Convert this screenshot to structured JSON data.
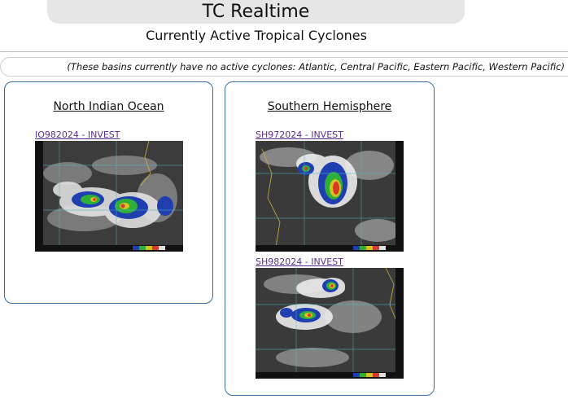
{
  "header": {
    "title": "TC Realtime",
    "subtitle": "Currently Active Tropical Cyclones"
  },
  "notice": "(These basins currently have no active cyclones: Atlantic, Central Pacific, Eastern Pacific, Western Pacific)",
  "basins": [
    {
      "name": "North Indian Ocean",
      "storms": [
        {
          "id": "IO982024 - INVEST",
          "image": "satellite-ir-image"
        }
      ]
    },
    {
      "name": "Southern Hemisphere",
      "storms": [
        {
          "id": "SH972024 - INVEST",
          "image": "satellite-ir-image"
        },
        {
          "id": "SH982024 - INVEST",
          "image": "satellite-ir-image"
        }
      ]
    }
  ],
  "colors": {
    "basin_border": "#3a6ea0",
    "link": "#5b2d8e",
    "title_bg": "#e6e6e6"
  }
}
